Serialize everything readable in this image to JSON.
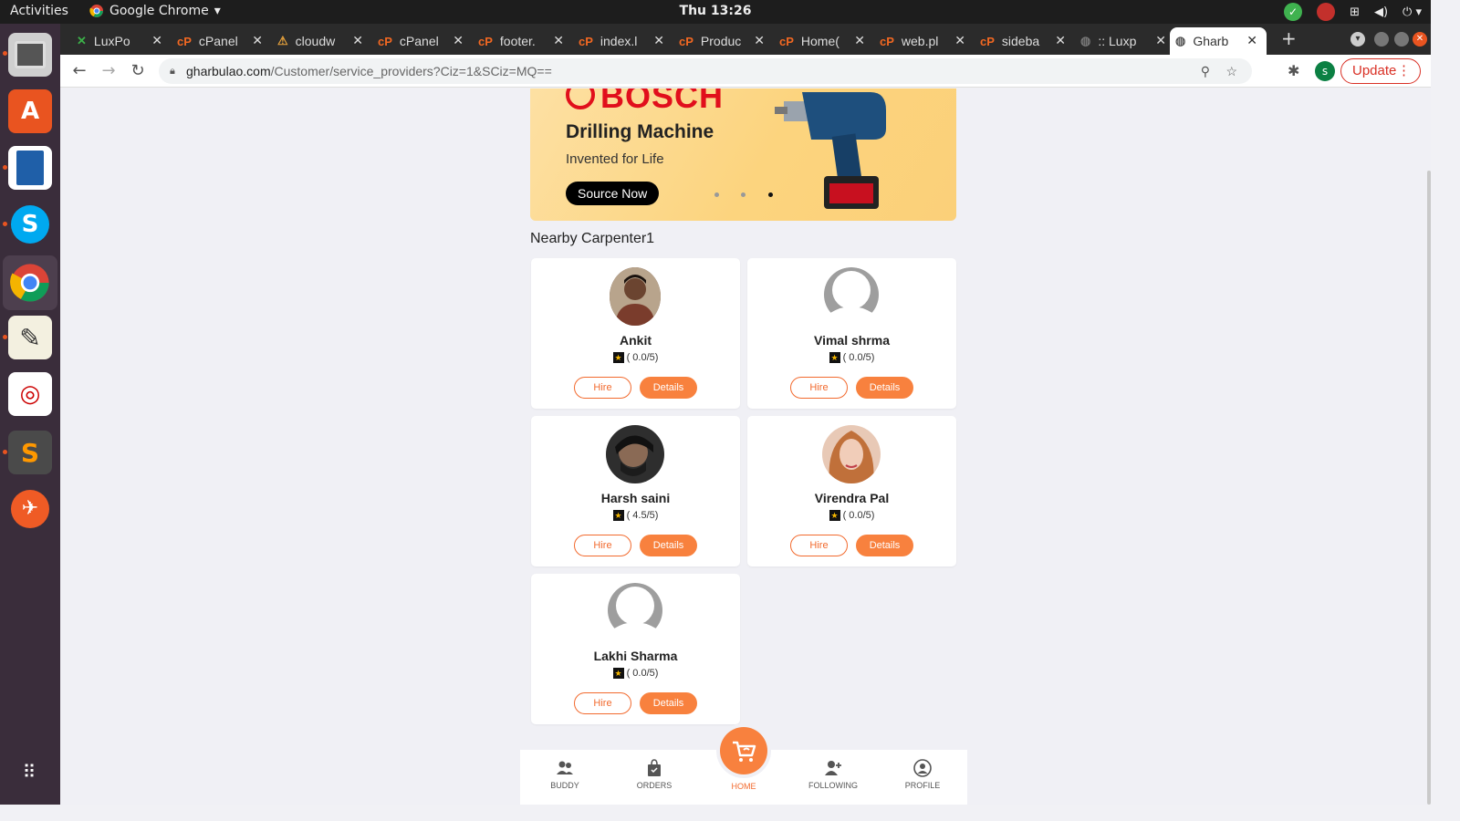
{
  "system_bar": {
    "activities": "Activities",
    "app_name": "Google Chrome",
    "clock": "Thu 13:26"
  },
  "tabs": [
    {
      "label": "LuxPo"
    },
    {
      "label": "cPanel"
    },
    {
      "label": "cloudw"
    },
    {
      "label": "cPanel"
    },
    {
      "label": "footer."
    },
    {
      "label": "index.l"
    },
    {
      "label": "Produc"
    },
    {
      "label": "Home("
    },
    {
      "label": "web.pl"
    },
    {
      "label": "sideba"
    },
    {
      "label": ":: Luxp"
    },
    {
      "label": "Gharb"
    }
  ],
  "address_bar": {
    "url_host": "gharbulao.com",
    "url_path": "/Customer/service_providers?Ciz=1&SCiz=MQ==",
    "profile_initial": "s",
    "update_label": "Update"
  },
  "banner": {
    "brand": "BOSCH",
    "title": "Drilling Machine",
    "subtitle": "Invented for Life",
    "cta": "Source Now",
    "active_slide": 3,
    "slide_count": 3
  },
  "section_title": "Nearby Carpenter1",
  "providers": [
    {
      "name": "Ankit",
      "rating": "( 0.0/5)",
      "hire": "Hire",
      "details": "Details",
      "avatar": "photo"
    },
    {
      "name": "Vimal shrma",
      "rating": "( 0.0/5)",
      "hire": "Hire",
      "details": "Details",
      "avatar": "placeholder"
    },
    {
      "name": "Harsh saini",
      "rating": "( 4.5/5)",
      "hire": "Hire",
      "details": "Details",
      "avatar": "photo"
    },
    {
      "name": "Virendra Pal",
      "rating": "( 0.0/5)",
      "hire": "Hire",
      "details": "Details",
      "avatar": "photo"
    },
    {
      "name": "Lakhi Sharma",
      "rating": "( 0.0/5)",
      "hire": "Hire",
      "details": "Details",
      "avatar": "placeholder"
    }
  ],
  "bottom_nav": {
    "buddy": "BUDDY",
    "orders": "ORDERS",
    "home": "HOME",
    "following": "FOLLOWING",
    "profile": "PROFILE"
  },
  "colors": {
    "accent": "#f8813e",
    "bosch_red": "#e10f1c",
    "banner_bg": "#fcd47e"
  }
}
